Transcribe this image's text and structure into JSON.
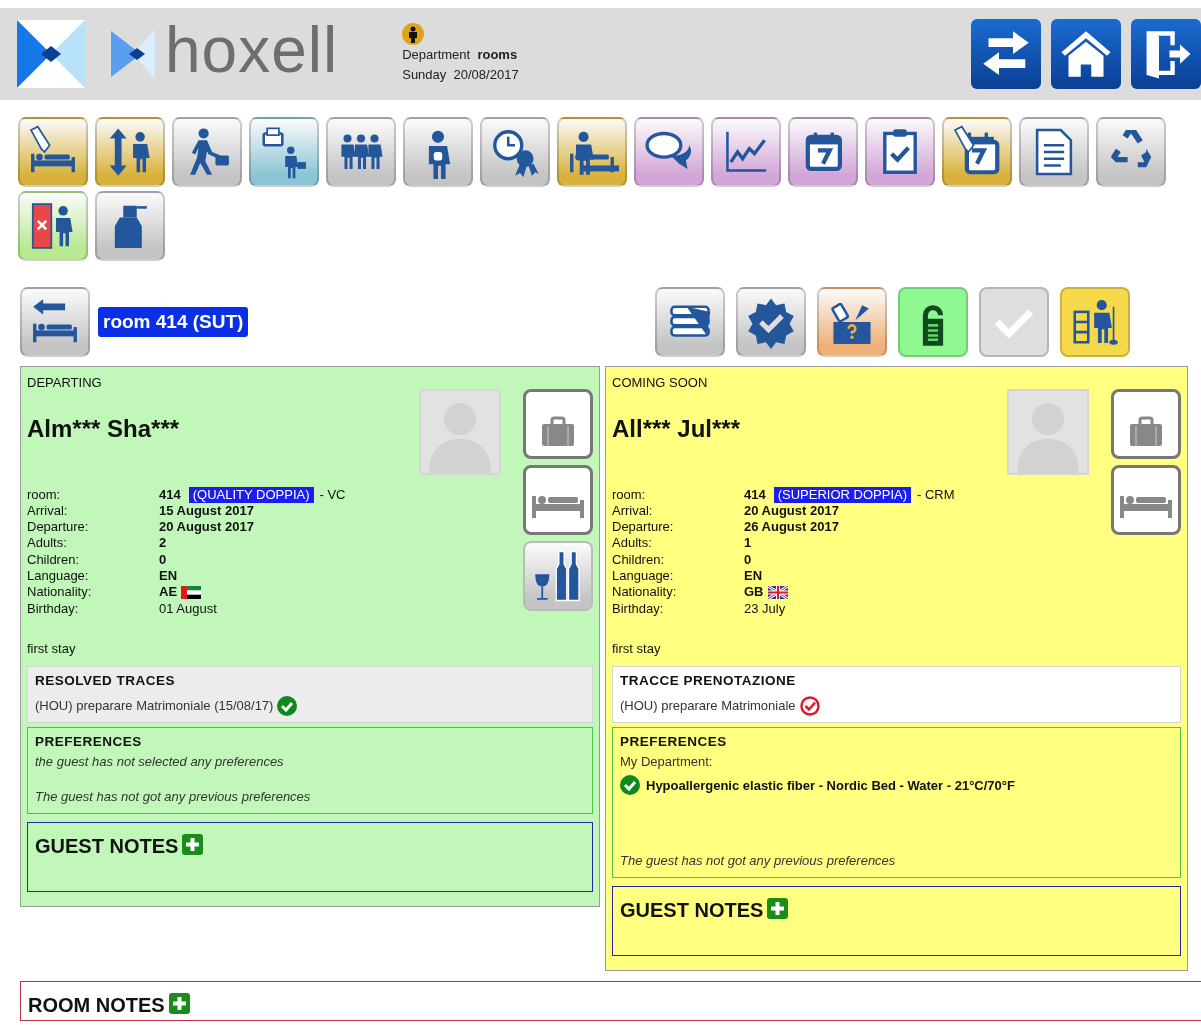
{
  "header": {
    "logo_text": "hoxell",
    "department_label": "Department",
    "department": "rooms",
    "day": "Sunday",
    "date": "20/08/2017",
    "nav_buttons": [
      {
        "kind": "swap"
      },
      {
        "kind": "home"
      },
      {
        "kind": "exit"
      }
    ]
  },
  "toolbar": [
    {
      "kind": "bed-edit",
      "color": "#d8b23c"
    },
    {
      "kind": "person-arrows",
      "color": "#d8b23c"
    },
    {
      "kind": "walker",
      "color": "#c4c4c4"
    },
    {
      "kind": "printer-walker",
      "color": "#8cc4d4"
    },
    {
      "kind": "people",
      "color": "#c4c4c4"
    },
    {
      "kind": "maid",
      "color": "#c4c4c4"
    },
    {
      "kind": "clock-award",
      "color": "#c4c4c4"
    },
    {
      "kind": "person-bed",
      "color": "#d8b23c"
    },
    {
      "kind": "chat",
      "color": "#d2a6d8"
    },
    {
      "kind": "chart",
      "color": "#d2a6d8"
    },
    {
      "kind": "calendar",
      "color": "#d2a6d8"
    },
    {
      "kind": "clipboard",
      "color": "#d2a6d8"
    },
    {
      "kind": "calendar-edit",
      "color": "#d8b23c"
    },
    {
      "kind": "document",
      "color": "#c4c4c4"
    },
    {
      "kind": "recycle",
      "color": "#c4c4c4"
    },
    {
      "kind": "door-repair",
      "color": "#b8e890"
    },
    {
      "kind": "spray",
      "color": "#c4c4c4"
    }
  ],
  "room": {
    "back": {
      "kind": "back-bed",
      "color": "#c4c4c4"
    },
    "label": "room 414 (SUT)"
  },
  "room_actions": [
    {
      "kind": "linen",
      "color": "#c4c4c4"
    },
    {
      "kind": "badge-check",
      "color": "#c4c4c4"
    },
    {
      "kind": "lost-found",
      "color": "#f0b078"
    },
    {
      "kind": "dnd",
      "color": "#90f890"
    },
    {
      "kind": "check",
      "color": "#dedede"
    },
    {
      "kind": "cleaning",
      "color": "#f5d94a"
    }
  ],
  "guests": [
    {
      "status": "DEPARTING",
      "color": "#c1f7b8",
      "name": "Alm*** Sha***",
      "fields": [
        {
          "kind": "room",
          "label": "room:",
          "value": "414",
          "bold": true,
          "tag": "(QUALITY DOPPIA)",
          "suffix": "- VC"
        },
        {
          "label": "Arrival:",
          "value": "15 August 2017",
          "bold": true
        },
        {
          "label": "Departure:",
          "value": "20 August 2017",
          "bold": true
        },
        {
          "label": "Adults:",
          "value": "2",
          "bold": true
        },
        {
          "label": "Children:",
          "value": "0",
          "bold": true
        },
        {
          "label": "Language:",
          "value": "EN",
          "bold": true
        },
        {
          "kind": "emirates",
          "label": "Nationality:",
          "value": "AE",
          "bold": true
        },
        {
          "label": "Birthday:",
          "value": "01 August",
          "bold": false
        }
      ],
      "note": "first stay",
      "side_buttons": [
        {
          "kind": "luggage"
        },
        {
          "kind": "bed"
        },
        {
          "kind": "wine"
        }
      ],
      "traces": {
        "title": "RESOLVED TRACES",
        "resolved": true,
        "items": [
          {
            "text": "(HOU) preparare Matrimoniale (15/08/17)",
            "done": true
          }
        ]
      },
      "preferences": {
        "title": "PREFERENCES",
        "items": [
          {
            "kind": "note",
            "text": "the guest has not selected any preferences"
          },
          {
            "kind": "history",
            "text": "The guest has not got any previous preferences"
          }
        ]
      },
      "guest_notes": {
        "title": "GUEST NOTES"
      }
    },
    {
      "status": "COMING SOON",
      "color": "#ffff80",
      "name": "All*** Jul***",
      "fields": [
        {
          "kind": "room",
          "label": "room:",
          "value": "414",
          "bold": true,
          "tag": "(SUPERIOR DOPPIA)",
          "suffix": "- CRM"
        },
        {
          "label": "Arrival:",
          "value": "20 August 2017",
          "bold": true
        },
        {
          "label": "Departure:",
          "value": "26 August 2017",
          "bold": true
        },
        {
          "label": "Adults:",
          "value": "1",
          "bold": true
        },
        {
          "label": "Children:",
          "value": "0",
          "bold": true
        },
        {
          "label": "Language:",
          "value": "EN",
          "bold": true
        },
        {
          "kind": "britain",
          "label": "Nationality:",
          "value": "GB",
          "bold": true
        },
        {
          "label": "Birthday:",
          "value": "23 July",
          "bold": false
        }
      ],
      "note": "first stay",
      "side_buttons": [
        {
          "kind": "luggage"
        },
        {
          "kind": "bed"
        }
      ],
      "traces": {
        "title": "TRACCE PRENOTAZIONE",
        "resolved": false,
        "items": [
          {
            "text": "(HOU) preparare Matrimoniale",
            "done": false
          }
        ]
      },
      "preferences": {
        "title": "PREFERENCES",
        "items": [
          {
            "kind": "group",
            "text": "My Department:"
          },
          {
            "kind": "choice",
            "text": "Hypoallergenic elastic fiber - Nordic Bed - Water - 21°C/70°F"
          },
          {
            "kind": "history",
            "text": "The guest has not got any previous preferences"
          }
        ]
      },
      "guest_notes": {
        "title": "GUEST NOTES"
      }
    }
  ],
  "room_notes": {
    "title": "ROOM NOTES"
  }
}
